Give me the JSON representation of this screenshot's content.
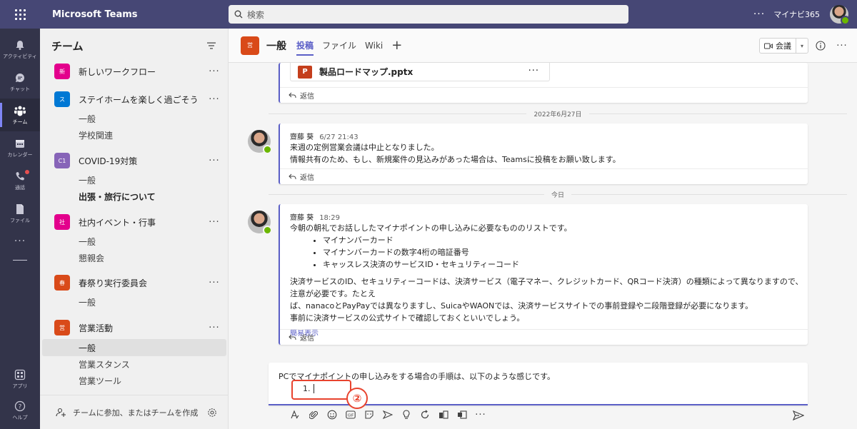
{
  "app": {
    "title": "Microsoft Teams",
    "org": "マイナビ365"
  },
  "search": {
    "placeholder": "検索"
  },
  "rail": [
    {
      "label": "アクティビティ",
      "icon": "bell-icon"
    },
    {
      "label": "チャット",
      "icon": "chat-icon"
    },
    {
      "label": "チーム",
      "icon": "teams-icon"
    },
    {
      "label": "カレンダー",
      "icon": "calendar-icon"
    },
    {
      "label": "通話",
      "icon": "phone-icon"
    },
    {
      "label": "ファイル",
      "icon": "file-icon"
    },
    {
      "label": "アプリ",
      "icon": "apps-icon"
    },
    {
      "label": "ヘルプ",
      "icon": "help-icon"
    }
  ],
  "teams_pane": {
    "title": "チーム",
    "teams": [
      {
        "badge": "新",
        "name": "新しいワークフロー",
        "color": "#e3008c"
      },
      {
        "badge": "ス",
        "name": "ステイホームを楽しく過ごそう",
        "color": "#0078d4"
      },
      {
        "badge": "C1",
        "name": "COVID-19対策",
        "color": "#8764b8"
      },
      {
        "badge": "社",
        "name": "社内イベント・行事",
        "color": "#e3008c"
      },
      {
        "badge": "春",
        "name": "春祭り実行委員会",
        "color": "#d94a19"
      },
      {
        "badge": "営",
        "name": "営業活動",
        "color": "#d94a19"
      }
    ],
    "channels": {
      "stay1": "一般",
      "stay2": "学校関連",
      "covid1": "一般",
      "covid2": "出張・旅行について",
      "event1": "一般",
      "event2": "懇親会",
      "spring1": "一般",
      "sales1": "一般",
      "sales2": "営業スタンス",
      "sales3": "営業ツール"
    },
    "footer": "チームに参加、またはチームを作成"
  },
  "channel": {
    "badge": "営",
    "name": "一般",
    "tabs": [
      "投稿",
      "ファイル",
      "Wiki"
    ],
    "meet_label": "会議"
  },
  "messages": {
    "file_name": "製品ロードマップ.pptx",
    "file_icon_letter": "P",
    "reply_label": "返信",
    "date1": "2022年6月27日",
    "date2": "今日",
    "m1": {
      "author": "齋藤 葵",
      "time": "6/27 21:43",
      "line1": "来週の定例営業会議は中止となりました。",
      "line2": "情報共有のため、もし、新規案件の見込みがあった場合は、Teamsに投稿をお願い致します。"
    },
    "m2": {
      "author": "齋藤 葵",
      "time": "18:29",
      "intro": "今朝の朝礼でお話ししたマイナポイントの申し込みに必要なもののリストです。",
      "bullets": [
        "マイナンバーカード",
        "マイナンバーカードの数字4桁の暗証番号",
        "キャッスレス決済のサービスID・セキュリティーコード"
      ],
      "para1": "決済サービスのID、セキュリティーコードは、決済サービス（電子マネー、クレジットカード、QRコード決済）の種類によって異なりますので、注意が必要です。たとえ",
      "para2": "ば、nanacoとPayPayでは異なりますし、SuicaやWAONでは、決済サービスサイトでの事前登録や二段階登録が必要になります。",
      "para3": "事前に決済サービスの公式サイトで確認しておくといいでしょう。",
      "collapse": "簡易表示"
    }
  },
  "compose": {
    "line1": "PCでマイナポイントの申し込みをする場合の手順は、以下のような感じです。",
    "line2": "1."
  },
  "annotation": {
    "label": "②",
    "color": "#e8432e"
  }
}
